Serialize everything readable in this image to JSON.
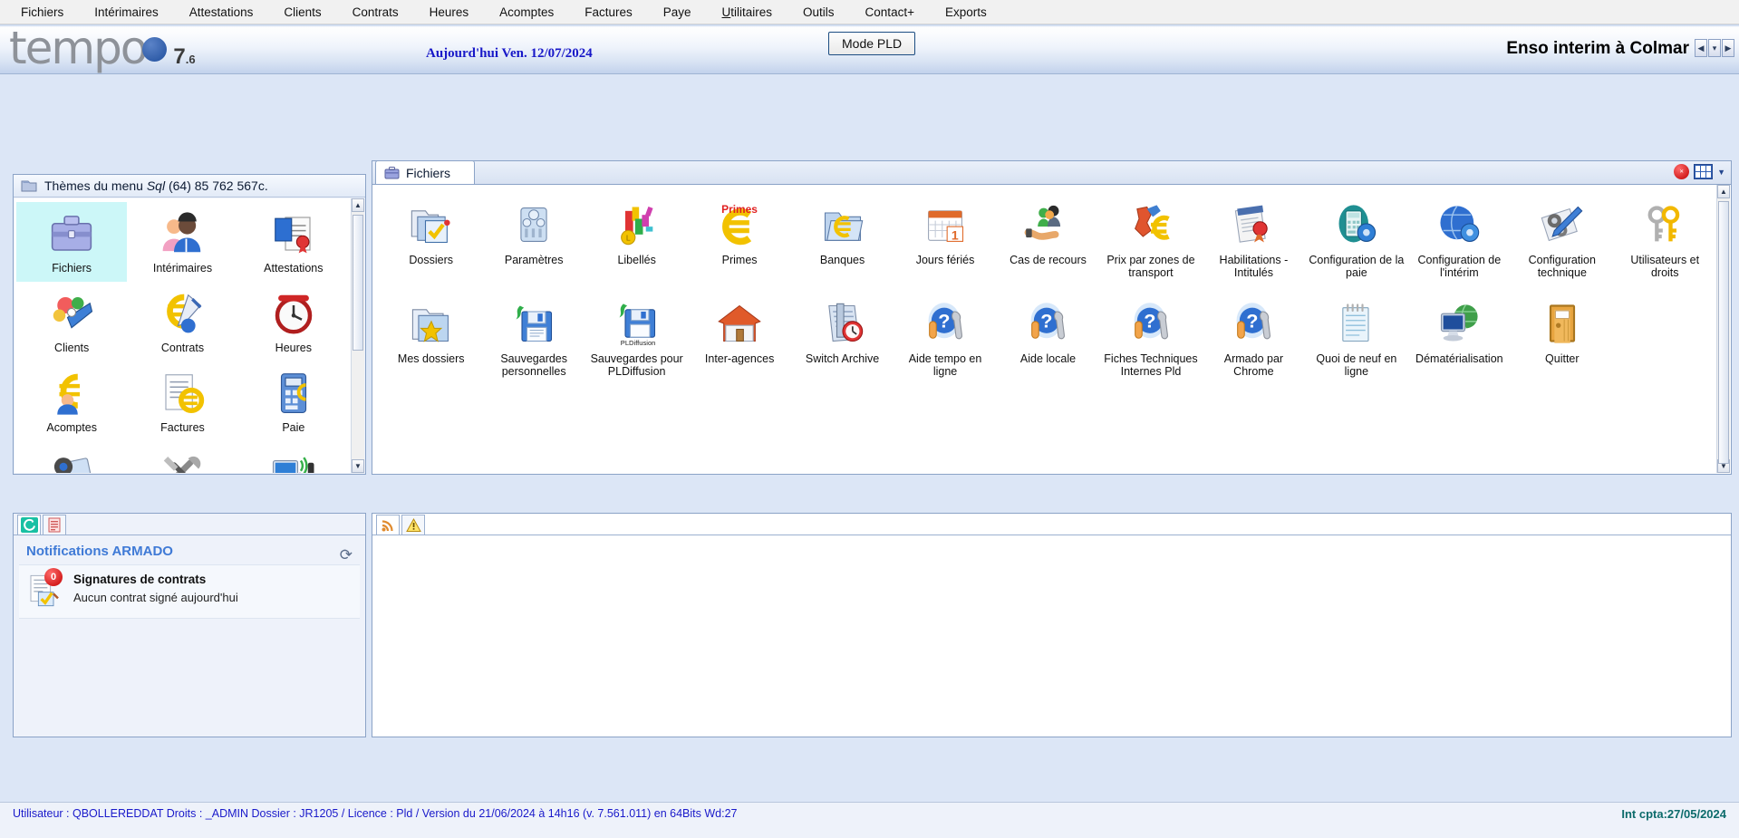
{
  "menubar": {
    "items": [
      {
        "label": "Fichiers",
        "accel": ""
      },
      {
        "label": "Intérimaires",
        "accel": ""
      },
      {
        "label": "Attestations",
        "accel": ""
      },
      {
        "label": "Clients",
        "accel": ""
      },
      {
        "label": "Contrats",
        "accel": ""
      },
      {
        "label": "Heures",
        "accel": ""
      },
      {
        "label": "Acomptes",
        "accel": ""
      },
      {
        "label": "Factures",
        "accel": ""
      },
      {
        "label": "Paye",
        "accel": ""
      },
      {
        "label": "Utilitaires",
        "accel": "U"
      },
      {
        "label": "Outils",
        "accel": ""
      },
      {
        "label": "Contact+",
        "accel": ""
      },
      {
        "label": "Exports",
        "accel": ""
      }
    ]
  },
  "header": {
    "logo_word": "tempo",
    "logo_version": "7",
    "logo_version_minor": ".6",
    "today": "Aujourd'hui Ven. 12/07/2024",
    "mode_button": "Mode PLD",
    "company": "Enso interim à Colmar",
    "nav_prev": "◀",
    "nav_drop": "▾",
    "nav_next": "▶"
  },
  "themes_panel": {
    "title_prefix": "Thèmes du menu",
    "title_italic": "Sql",
    "title_suffix": "(64)  85 762 567c.",
    "items": [
      {
        "label": "Fichiers",
        "icon": "briefcase-icon",
        "selected": true
      },
      {
        "label": "Intérimaires",
        "icon": "people-icon",
        "selected": false
      },
      {
        "label": "Attestations",
        "icon": "certificate-icon",
        "selected": false
      },
      {
        "label": "Clients",
        "icon": "clients-icon",
        "selected": false
      },
      {
        "label": "Contrats",
        "icon": "contracts-euro-icon",
        "selected": false
      },
      {
        "label": "Heures",
        "icon": "clock-icon",
        "selected": false
      },
      {
        "label": "Acomptes",
        "icon": "euro-person-icon",
        "selected": false
      },
      {
        "label": "Factures",
        "icon": "invoice-icon",
        "selected": false
      },
      {
        "label": "Paie",
        "icon": "calculator-euro-icon",
        "selected": false
      },
      {
        "label": "",
        "icon": "gears-icon",
        "selected": false
      },
      {
        "label": "",
        "icon": "tools-icon",
        "selected": false
      },
      {
        "label": "",
        "icon": "monitor-signal-icon",
        "selected": false
      }
    ]
  },
  "files_panel": {
    "tab_label": "Fichiers",
    "tab_icon": "briefcase-icon",
    "tools": {
      "close_icon": "close-round-icon",
      "view_icon": "grid-view-icon",
      "caret_icon": "chevron-down-icon"
    },
    "items": [
      {
        "label": "Dossiers",
        "icon": "folder-check-icon"
      },
      {
        "label": "Paramètres",
        "icon": "sliders-icon"
      },
      {
        "label": "Libellés",
        "icon": "colored-blocks-icon"
      },
      {
        "label": "Primes",
        "icon": "primes-euro-icon"
      },
      {
        "label": "Banques",
        "icon": "bank-folder-euro-icon"
      },
      {
        "label": "Jours fériés",
        "icon": "calendar-icon"
      },
      {
        "label": "Cas de recours",
        "icon": "hand-people-icon"
      },
      {
        "label": "Prix par zones de transport",
        "icon": "map-euro-icon"
      },
      {
        "label": "Habilitations - Intitulés",
        "icon": "habilitation-seal-icon"
      },
      {
        "label": "Configuration de la paie",
        "icon": "calculator-gear-icon"
      },
      {
        "label": "Configuration de l'intérim",
        "icon": "globe-gear-icon"
      },
      {
        "label": "Configuration technique",
        "icon": "gear-pen-icon"
      },
      {
        "label": "Utilisateurs et droits",
        "icon": "keys-wrench-icon"
      },
      {
        "label": "Mes dossiers",
        "icon": "folder-star-icon"
      },
      {
        "label": "Sauvegardes personnelles",
        "icon": "floppy-save-icon"
      },
      {
        "label": "Sauvegardes pour PLDiffusion",
        "icon": "floppy-pld-icon"
      },
      {
        "label": "Inter-agences",
        "icon": "house-icon"
      },
      {
        "label": "Switch Archive",
        "icon": "archive-clock-icon"
      },
      {
        "label": "Aide tempo en ligne",
        "icon": "help-wrench-icon"
      },
      {
        "label": "Aide locale",
        "icon": "help-wrench-icon"
      },
      {
        "label": "Fiches Techniques Internes Pld",
        "icon": "help-wrench-icon"
      },
      {
        "label": "Armado par Chrome",
        "icon": "help-wrench-icon"
      },
      {
        "label": "Quoi de neuf en ligne",
        "icon": "notepad-icon"
      },
      {
        "label": "Dématérialisation",
        "icon": "monitor-globe-icon"
      },
      {
        "label": "Quitter",
        "icon": "door-icon"
      }
    ]
  },
  "notifications_panel": {
    "tabs": [
      {
        "icon": "armado-logo-icon",
        "active": true
      },
      {
        "icon": "document-red-icon",
        "active": false
      }
    ],
    "title": "Notifications ARMADO",
    "refresh_icon": "refresh-icon",
    "items": [
      {
        "icon": "contract-sign-icon",
        "badge": "0",
        "title": "Signatures de contrats",
        "subtitle": "Aucun contrat signé aujourd'hui"
      }
    ]
  },
  "rss_panel": {
    "tabs": [
      {
        "icon": "rss-icon",
        "active": true
      },
      {
        "icon": "warning-icon",
        "active": false
      }
    ]
  },
  "statusbar": {
    "left": "Utilisateur : QBOLLEREDDAT   Droits : _ADMIN   Dossier : JR1205 /  Licence : Pld /  Version du 21/06/2024 à 14h16 (v. 7.561.011)  en 64Bits    Wd:27",
    "right": "Int cpta:27/05/2024"
  },
  "colors": {
    "accent_blue": "#1f4e9c",
    "selection": "#ccf7f8",
    "notif_title": "#3f7ad6",
    "status_text": "#1a1aca",
    "status_right": "#0c6b6b"
  }
}
